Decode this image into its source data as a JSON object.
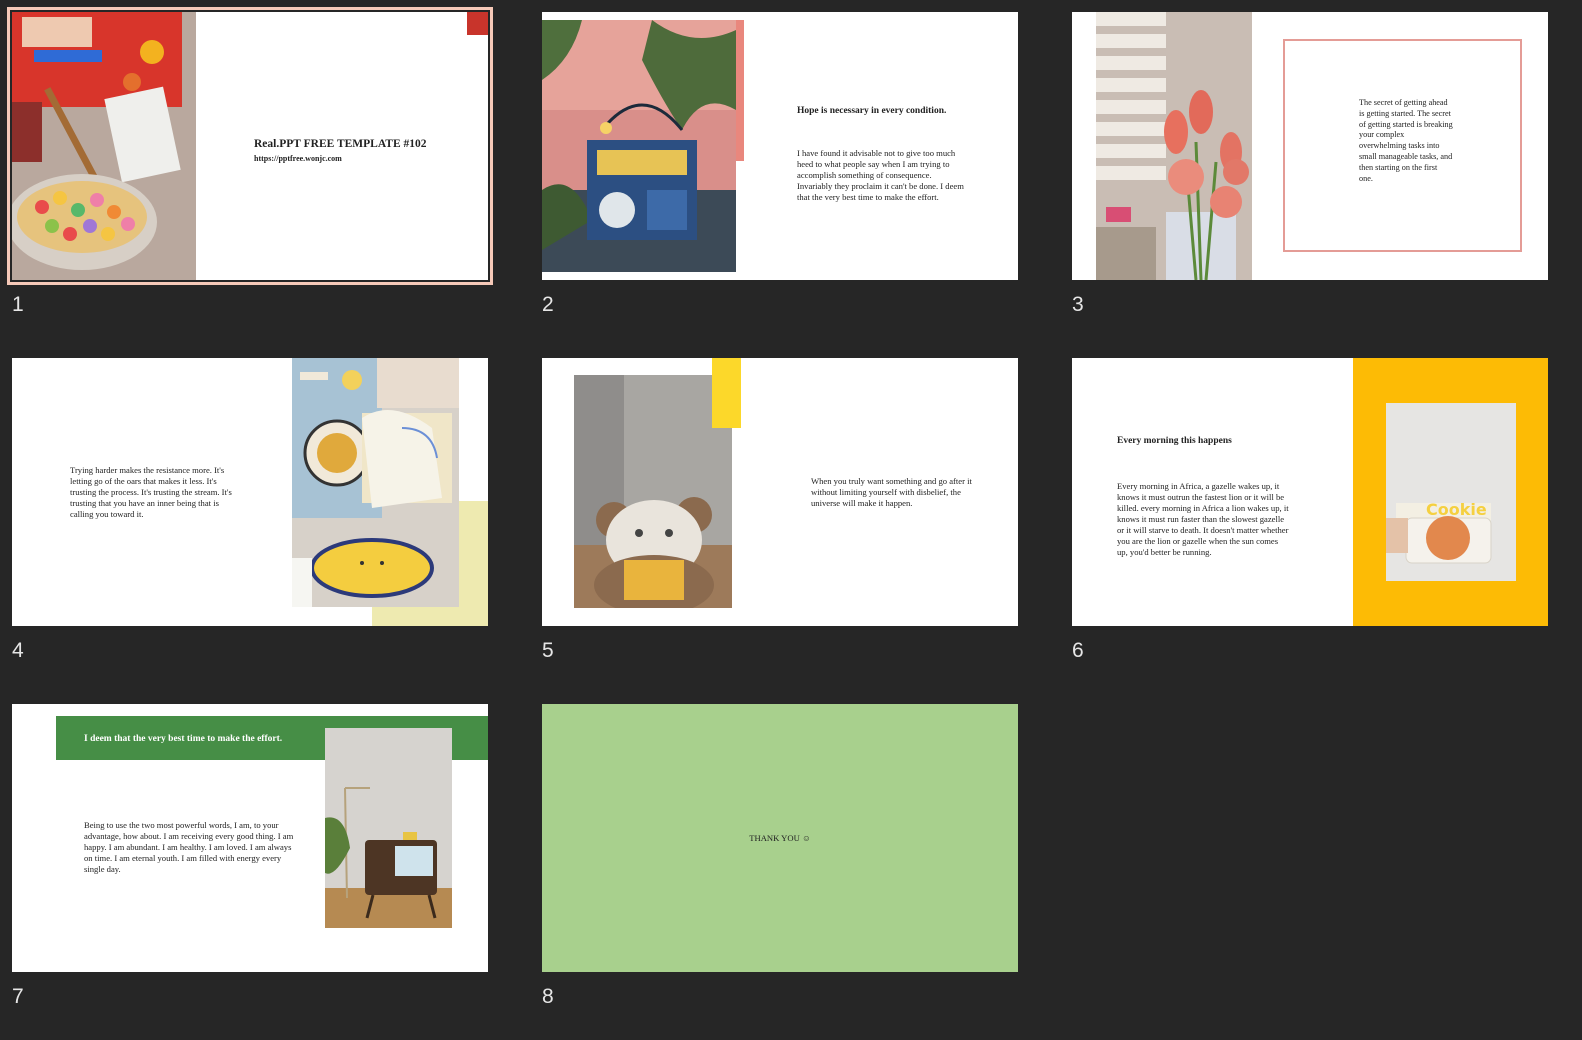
{
  "slides": [
    {
      "number": "1",
      "title": "Real.PPT FREE TEMPLATE #102",
      "url": "https://pptfree.wonjc.com",
      "photo": "cereal-photo"
    },
    {
      "number": "2",
      "heading": "Hope is necessary in every condition.",
      "body": "I have found it advisable not to give too much heed to what people say when I am trying to accomplish something of consequence. Invariably they proclaim it can't be done. I deem that the very best time to make the effort.",
      "photo": "clock-sign-photo"
    },
    {
      "number": "3",
      "body": "The secret of  getting ahead is getting started. The secret of  getting started is breaking your complex overwhelming tasks into small manageable tasks, and then starting on the first one.",
      "photo": "tulips-photo"
    },
    {
      "number": "4",
      "body": "Trying harder makes the resistance more. It's letting go of  the oars that makes it less. It's trusting the process. It's trusting the stream. It's trusting that you have an inner being that is calling you toward it.",
      "photo": "laundry-room-photo"
    },
    {
      "number": "5",
      "body": "When you truly want something and go after it without limiting yourself  with disbelief, the universe will make it happen.",
      "photo": "teddy-bear-photo"
    },
    {
      "number": "6",
      "heading": "Every morning this happens",
      "body": "Every morning in Africa, a gazelle wakes up, it knows it must outrun the fastest lion or it will be killed. every morning in Africa a lion wakes up, it knows it must run faster than the slowest gazelle or it will starve to death. It doesn't matter whether you are the lion or gazelle when the sun comes up, you'd better be running.",
      "photo": "cookie-box-photo",
      "photo_label": "Cookie"
    },
    {
      "number": "7",
      "banner": "I deem that the very best time to make the effort.",
      "body": "Being to use the two most powerful words, I am, to your advantage, how about. I am receiving every good thing. I am happy. I am abundant. I am healthy. I am loved. I am always on time. I am eternal youth. I am filled with energy every single day.",
      "photo": "retro-tv-photo"
    },
    {
      "number": "8",
      "body": "THANK YOU ☺"
    }
  ],
  "colors": {
    "background": "#262626",
    "selection": "#f6c9b8",
    "salmon": "#e9877d",
    "yellow": "#fcd82a",
    "pale_yellow": "#eeeab0",
    "amber": "#fdbb05",
    "green": "#468e46",
    "mint": "#a8d08d"
  }
}
